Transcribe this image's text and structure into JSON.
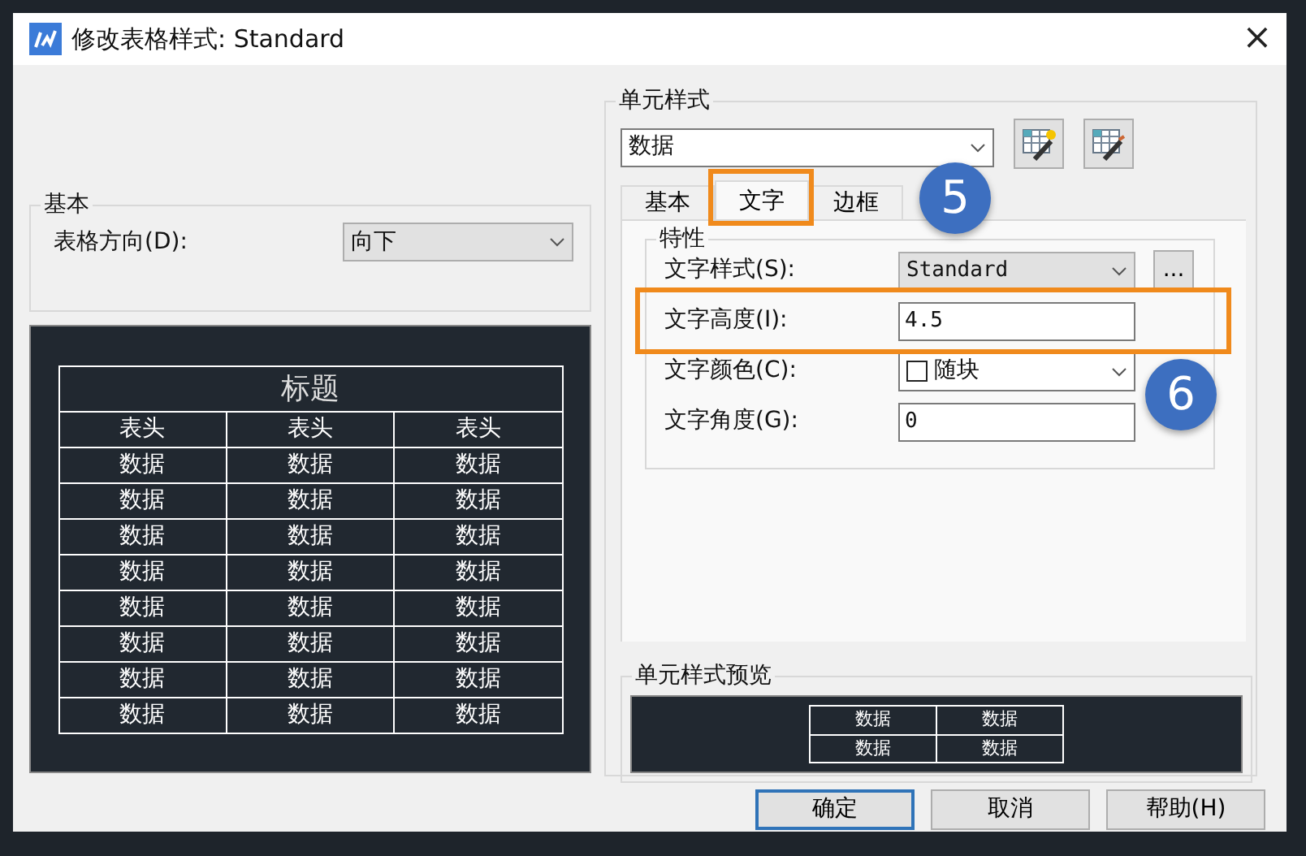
{
  "window": {
    "title": "修改表格样式: Standard",
    "close": "×"
  },
  "basic_group": {
    "title": "基本",
    "direction_label": "表格方向(D):",
    "direction_value": "向下"
  },
  "table_preview": {
    "title_cell": "标题",
    "headers": [
      "表头",
      "表头",
      "表头"
    ],
    "rows": [
      [
        "数据",
        "数据",
        "数据"
      ],
      [
        "数据",
        "数据",
        "数据"
      ],
      [
        "数据",
        "数据",
        "数据"
      ],
      [
        "数据",
        "数据",
        "数据"
      ],
      [
        "数据",
        "数据",
        "数据"
      ],
      [
        "数据",
        "数据",
        "数据"
      ],
      [
        "数据",
        "数据",
        "数据"
      ],
      [
        "数据",
        "数据",
        "数据"
      ]
    ]
  },
  "cell_styles": {
    "title": "单元样式",
    "selected_style": "数据",
    "tabs": [
      {
        "label": "基本",
        "selected": false
      },
      {
        "label": "文字",
        "selected": true
      },
      {
        "label": "边框",
        "selected": false
      }
    ],
    "properties": {
      "title": "特性",
      "fields": [
        {
          "kind": "combo",
          "label": "文字样式(S):",
          "value": "Standard",
          "disabled": true,
          "extra_button": "..."
        },
        {
          "kind": "text",
          "label": "文字高度(I):",
          "value": "4.5"
        },
        {
          "kind": "color",
          "label": "文字颜色(C):",
          "value": "随块"
        },
        {
          "kind": "text",
          "label": "文字角度(G):",
          "value": "0"
        }
      ]
    },
    "preview": {
      "title": "单元样式预览",
      "rows": [
        [
          "数据",
          "数据"
        ],
        [
          "数据",
          "数据"
        ]
      ]
    }
  },
  "buttons": [
    {
      "label": "确定",
      "default": true
    },
    {
      "label": "取消",
      "default": false
    },
    {
      "label": "帮助(H)",
      "default": false
    }
  ],
  "callouts": [
    {
      "label": "5"
    },
    {
      "label": "6"
    }
  ]
}
